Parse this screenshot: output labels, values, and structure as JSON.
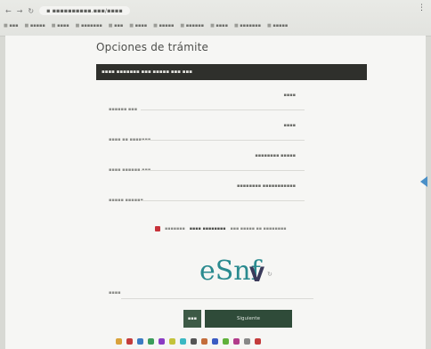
{
  "browser": {
    "back": "←",
    "forward": "→",
    "reload": "↻",
    "url": "▪ ▪▪▪▪▪▪▪▪▪▪.▪▪▪/▪▪▪▪",
    "bookmarks": [
      "▪▪▪",
      "▪▪▪▪▪",
      "▪▪▪▪",
      "▪▪▪▪▪▪▪",
      "▪▪▪",
      "▪▪▪▪",
      "▪▪▪▪▪",
      "▪▪▪▪▪▪",
      "▪▪▪▪",
      "▪▪▪▪▪▪▪",
      "▪▪▪▪▪"
    ],
    "menu_icon": "⋮"
  },
  "page": {
    "title": "Opciones de trámite",
    "banner": "▪▪▪▪ ▪▪▪▪▪▪▪ ▪▪▪ ▪▪▪▪▪ ▪▪▪ ▪▪▪",
    "fields": [
      {
        "label": "▪▪▪▪▪▪ ▪▪▪",
        "value": "▪▪▪▪"
      },
      {
        "label": "▪▪▪▪ ▪▪ ▪▪▪▪▪▪▪",
        "value": "▪▪▪▪"
      },
      {
        "label": "▪▪▪▪ ▪▪▪▪▪▪ ▪▪▪",
        "value": "▪▪▪▪▪▪▪▪ ▪▪▪▪▪"
      },
      {
        "label": "▪▪▪▪▪ ▪▪▪▪▪▪",
        "value": "▪▪▪▪▪▪▪▪ ▪▪▪▪▪▪▪▪▪▪▪"
      }
    ],
    "consent": {
      "pre": "▪▪▪▪▪▪▪",
      "bold": "▪▪▪▪ ▪▪▪▪▪▪▪▪",
      "post": "▪▪▪ ▪▪▪▪▪ ▪▪ ▪▪▪▪▪▪▪▪"
    },
    "captcha": {
      "text": "eSnf",
      "tail": "V",
      "refresh": "↻"
    },
    "captcha_input": {
      "label": "▪▪▪▪",
      "placeholder": ""
    },
    "buttons": {
      "back": "▪▪▪",
      "next": "Siguiente"
    }
  },
  "colors": {
    "banner": "#2f302c",
    "primary_button": "#2f4b39",
    "checkbox": "#c7323a",
    "side_arrow": "#4a90c8"
  },
  "taskbar": [
    "#d9a23b",
    "#c33b3b",
    "#3b7bc3",
    "#3b9c5a",
    "#8a3bc3",
    "#c3c33b",
    "#3bb8c3",
    "#555555",
    "#c36d3b",
    "#3b5cc3",
    "#5fb13b",
    "#b13b8a",
    "#888888",
    "#c33b3b"
  ]
}
